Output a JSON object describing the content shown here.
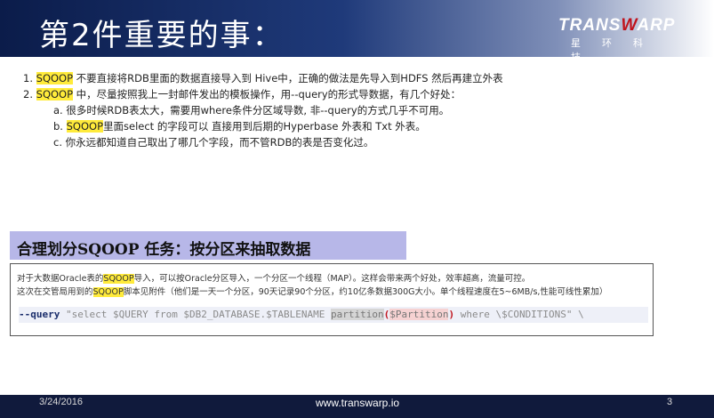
{
  "header": {
    "title": "第2件重要的事：",
    "logo_word_a": "TRANS",
    "logo_word_b": "W",
    "logo_word_c": "ARP",
    "logo_cn": "星环科技"
  },
  "list": {
    "item1_num": "1.",
    "item1_hl": "SQOOP",
    "item1_text": " 不要直接将RDB里面的数据直接导入到 Hive中，正确的做法是先导入到HDFS 然后再建立外表",
    "item2_num": "2.",
    "item2_hl": "SQOOP",
    "item2_text": " 中，尽量按照我上一封邮件发出的模板操作，用--query的形式导数据，有几个好处：",
    "sub_a": "a. 很多时候RDB表太大，需要用where条件分区域导数, 非--query的方式几乎不可用。",
    "sub_b_prefix": "b. ",
    "sub_b_hl": "SQOOP",
    "sub_b_text": "里面select 的字段可以 直接用到后期的Hyperbase 外表和 Txt 外表。",
    "sub_c": "c. 你永远都知道自己取出了哪几个字段，而不管RDB的表是否变化过。"
  },
  "section": {
    "title": "合理划分SQOOP 任务：按分区来抽取数据"
  },
  "box": {
    "line1_prefix": "对于大数据Oracle表的",
    "line1_hl": "SQOOP",
    "line1_text": "导入，可以按Oracle分区导入，一个分区一个线程（MAP）。这样会带来两个好处，效率超高，流量可控。",
    "line2_prefix": "这次在交管局用到的",
    "line2_hl": "SQOOP",
    "line2_text": "脚本见附件（他们是一天一个分区，90天记录90个分区，约10亿条数据300G大小。单个线程速度在5~6MB/s,性能可线性累加）",
    "code_kw": "--query",
    "code_str1": " \"select $QUERY from $DB2_DATABASE.$TABLENAME ",
    "code_part": "partition",
    "code_open": "(",
    "code_var": "$Partition",
    "code_close": ")",
    "code_str2": " where \\$CONDITIONS\" \\"
  },
  "footer": {
    "date": "3/24/2016",
    "url": "www.transwarp.io",
    "page": "3"
  }
}
